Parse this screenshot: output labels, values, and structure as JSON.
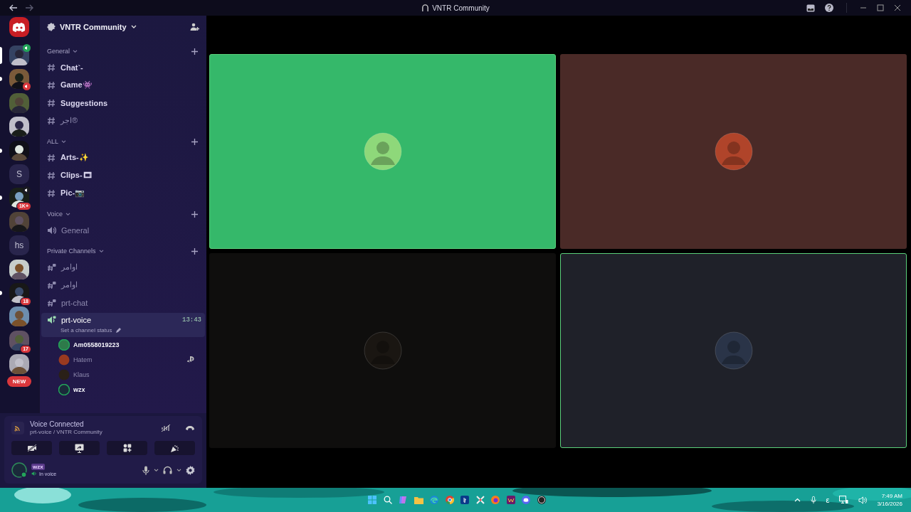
{
  "title_bar": {
    "title": "VNTR Community"
  },
  "servers": [
    {
      "kind": "picture",
      "selected": true,
      "unread": false,
      "voice": {
        "color": "#23a55a"
      }
    },
    {
      "kind": "picture",
      "selected": false,
      "unread": true,
      "voice": {
        "color": "#da373c"
      }
    },
    {
      "kind": "picture",
      "selected": false,
      "unread": false
    },
    {
      "kind": "picture",
      "selected": false,
      "unread": false
    },
    {
      "kind": "picture",
      "selected": false,
      "unread": true
    },
    {
      "kind": "letter",
      "label": "S",
      "selected": false,
      "unread": false
    },
    {
      "kind": "picture",
      "selected": false,
      "unread": true,
      "voice": {
        "color": "#1a1a22"
      },
      "badge": "1K+"
    },
    {
      "kind": "picture",
      "selected": false,
      "unread": false
    },
    {
      "kind": "letter",
      "label": "hs",
      "selected": false,
      "unread": false
    },
    {
      "kind": "picture",
      "selected": false,
      "unread": false
    },
    {
      "kind": "picture",
      "selected": false,
      "unread": true,
      "badge": "18"
    },
    {
      "kind": "picture",
      "selected": false,
      "unread": false
    },
    {
      "kind": "picture",
      "selected": false,
      "unread": false,
      "badge": "17"
    },
    {
      "kind": "picture",
      "selected": false,
      "unread": false
    }
  ],
  "new_badge": "NEW",
  "server_header": {
    "name": "VNTR Community"
  },
  "categories": [
    {
      "name": "General",
      "channels": [
        {
          "name": "Chat`-",
          "kind": "text",
          "selected": false,
          "unread": true
        },
        {
          "name": "Game👾",
          "kind": "text",
          "selected": false,
          "unread": true
        },
        {
          "name": "Suggestions",
          "kind": "text",
          "selected": false,
          "unread": true
        },
        {
          "name": "اجر®",
          "kind": "text",
          "selected": false,
          "unread": false
        }
      ]
    },
    {
      "name": "ALL",
      "channels": [
        {
          "name": "Arts-✨",
          "kind": "text",
          "selected": false,
          "unread": true
        },
        {
          "name": "Clips-🎞",
          "kind": "text",
          "selected": false,
          "unread": true
        },
        {
          "name": "Pic-📷",
          "kind": "text",
          "selected": false,
          "unread": true
        }
      ]
    },
    {
      "name": "Voice",
      "channels": [
        {
          "name": "General",
          "kind": "voice",
          "selected": false,
          "unread": false
        }
      ]
    },
    {
      "name": "Private Channels",
      "channels": [
        {
          "name": "اوامر",
          "kind": "private-text",
          "selected": false,
          "unread": false
        },
        {
          "name": "اوامر",
          "kind": "private-text",
          "selected": false,
          "unread": false
        },
        {
          "name": "prt-chat",
          "kind": "private-text",
          "selected": false,
          "unread": false
        },
        {
          "name": "prt-voice",
          "kind": "private-voice",
          "selected": true,
          "unread": true,
          "time": "13:43",
          "status": "Set a channel status",
          "members": [
            {
              "name": "Am0558019223",
              "speaking": true,
              "activity": false
            },
            {
              "name": "Hatem",
              "speaking": false,
              "activity": true
            },
            {
              "name": "Klaus",
              "speaking": false,
              "activity": false
            },
            {
              "name": "wzx",
              "speaking": true,
              "activity": false
            }
          ]
        }
      ]
    }
  ],
  "voice_panel": {
    "status": "Voice Connected",
    "location": "prt-voice / VNTR Community"
  },
  "user": {
    "name": "wzx",
    "status": "In voice"
  },
  "tiles": [
    {
      "color": "#35b86a",
      "speaking": true
    },
    {
      "color": "#4a2a27",
      "speaking": false
    },
    {
      "color": "#0f0e0d",
      "speaking": false
    },
    {
      "color": "#1f2129",
      "speaking": true
    }
  ],
  "taskbar": {
    "input_indicator": "ε",
    "time": "7:49 AM",
    "date": "3/16/2026"
  }
}
